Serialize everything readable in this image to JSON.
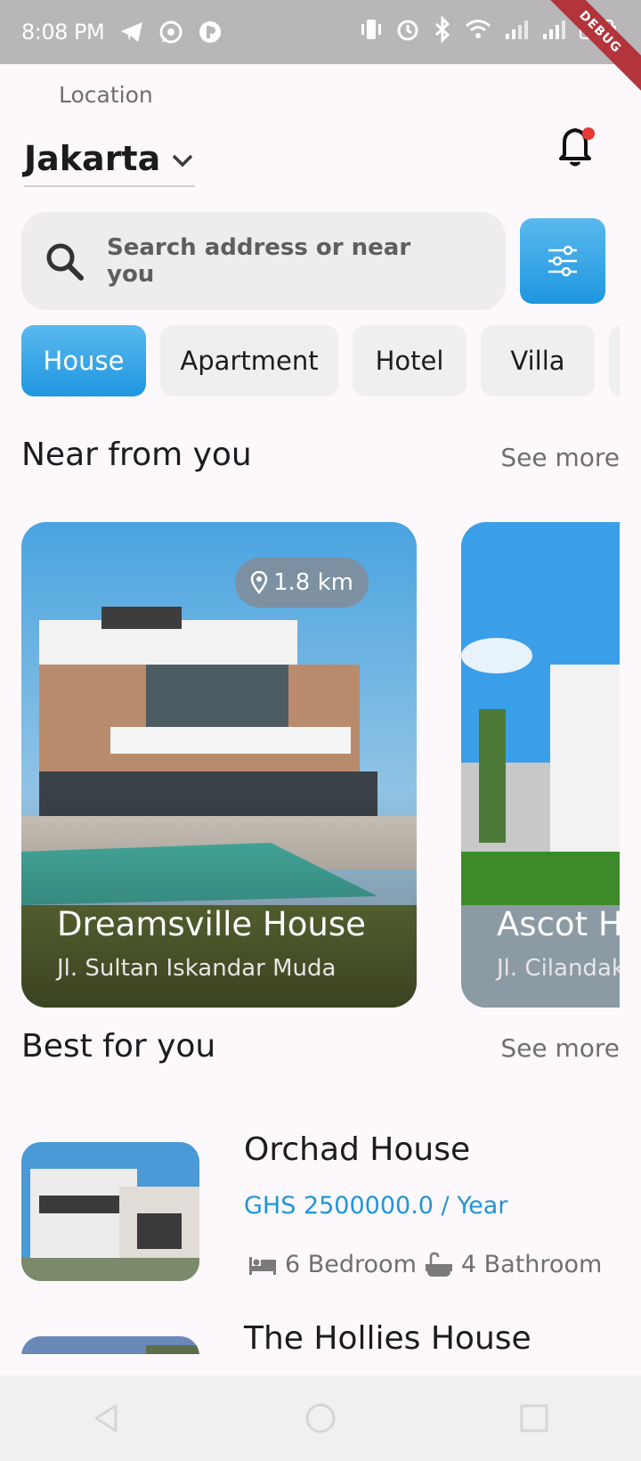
{
  "status_bar": {
    "time": "8:08 PM",
    "debug_label": "DEBUG",
    "left_icons": [
      "telegram-icon",
      "whatsapp-icon",
      "pocket-icon"
    ],
    "right_icons": [
      "vibrate-icon",
      "alarm-icon",
      "bluetooth-icon",
      "wifi-icon",
      "signal-icon",
      "signal-icon",
      "battery-icon"
    ]
  },
  "location": {
    "label": "Location",
    "value": "Jakarta"
  },
  "notification": {
    "has_unread": true,
    "dot_color": "#e53935"
  },
  "search": {
    "placeholder": "Search address or near you"
  },
  "categories": [
    {
      "label": "House",
      "active": true
    },
    {
      "label": "Apartment",
      "active": false
    },
    {
      "label": "Hotel",
      "active": false
    },
    {
      "label": "Villa",
      "active": false
    },
    {
      "label": "",
      "active": false
    }
  ],
  "near": {
    "title": "Near from you",
    "see_more": "See more",
    "cards": [
      {
        "name": "Dreamsville House",
        "address": "Jl. Sultan Iskandar Muda",
        "distance": "1.8 km"
      },
      {
        "name": "Ascot House",
        "address": "Jl. Cilandak Tengah",
        "distance": ""
      }
    ]
  },
  "best": {
    "title": "Best for you",
    "see_more": "See more",
    "items": [
      {
        "name": "Orchad House",
        "price": "GHS 2500000.0 / Year",
        "bedroom": "6 Bedroom",
        "bathroom": "4 Bathroom"
      },
      {
        "name": "The Hollies House"
      }
    ]
  },
  "colors": {
    "accent": "#2196d6",
    "accent_light": "#5ab9ee",
    "chip_bg": "#efefef"
  },
  "nav": [
    "back-icon",
    "home-icon",
    "recents-icon"
  ]
}
